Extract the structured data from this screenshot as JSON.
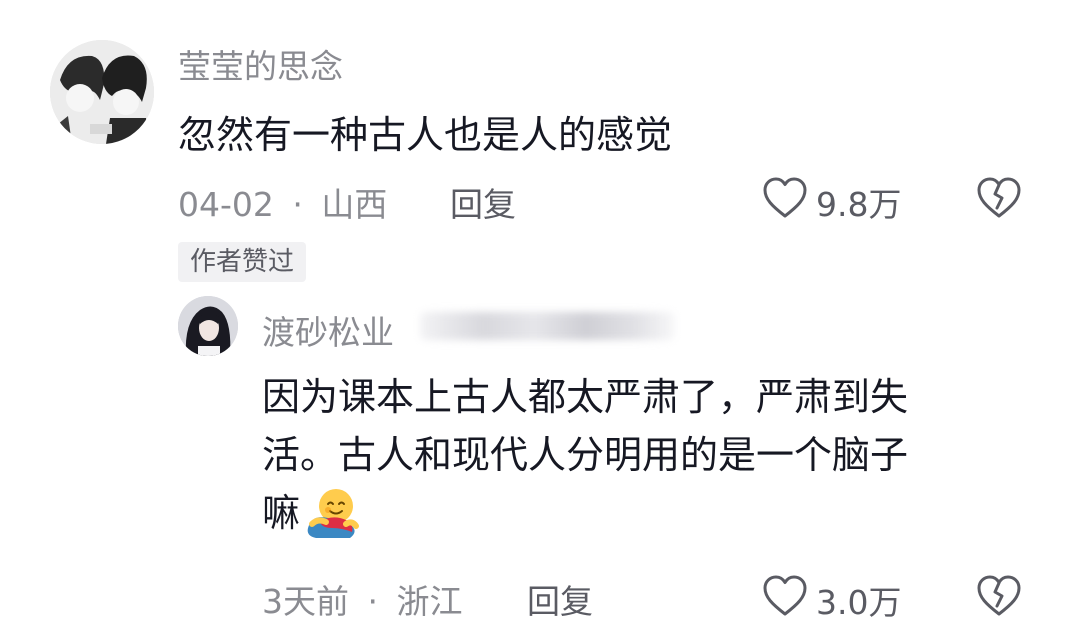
{
  "comment": {
    "username": "莹莹的思念",
    "text": "忽然有一种古人也是人的感觉",
    "date": "04-02",
    "separator": "·",
    "location": "山西",
    "reply_label": "回复",
    "like_count": "9.8万",
    "author_badge": "作者赞过",
    "avatar_icon": "anime-couple-avatar"
  },
  "reply": {
    "username": "渡砂松业",
    "text_lines": [
      "因为课本上古人都太严肃了，严肃到失",
      "活。古人和现代人分明用的是一个脑子",
      "嘛"
    ],
    "emoji_icon": "hugging-face-emoji",
    "date": "3天前",
    "separator": "·",
    "location": "浙江",
    "reply_label": "回复",
    "like_count": "3.0万",
    "avatar_icon": "girl-portrait-avatar"
  },
  "colors": {
    "primary_text": "#161823",
    "secondary_text": "#8a8b91",
    "icon_stroke": "#5a5b63",
    "badge_bg": "#f1f1f3"
  }
}
